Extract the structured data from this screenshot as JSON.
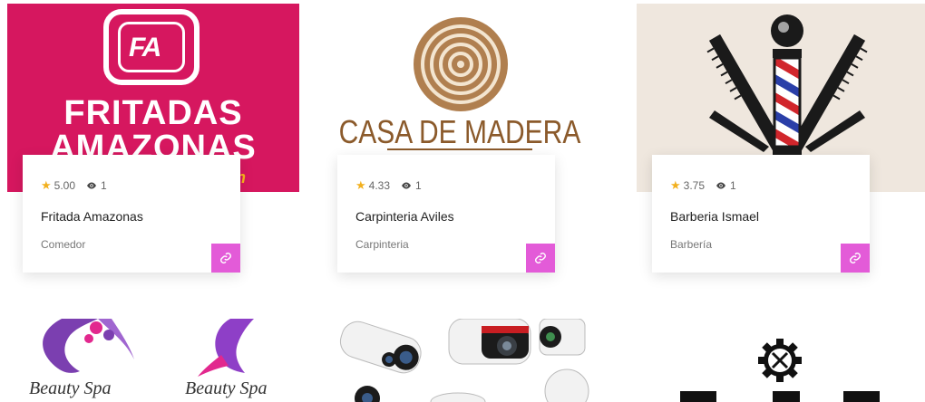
{
  "listings": [
    {
      "logo_line1": "FRITADAS",
      "logo_line2": "AMAZONAS",
      "rating": "5.00",
      "views": "1",
      "title": "Fritada Amazonas",
      "category": "Comedor"
    },
    {
      "logo_line1": "CASA DE MADERA",
      "rating": "4.33",
      "views": "1",
      "title": "Carpinteria Aviles",
      "category": "Carpinteria"
    },
    {
      "rating": "3.75",
      "views": "1",
      "title": "Barberia Ismael",
      "category": "Barbería"
    }
  ],
  "row2": {
    "beauty_spa_text": "Beauty Spa"
  },
  "colors": {
    "accent": "#e35bd8",
    "star": "#f2b01e",
    "fritadas_bg": "#d6175f"
  },
  "icons": [
    "star-icon",
    "eye-icon",
    "link-icon",
    "gear-tools-icon"
  ]
}
